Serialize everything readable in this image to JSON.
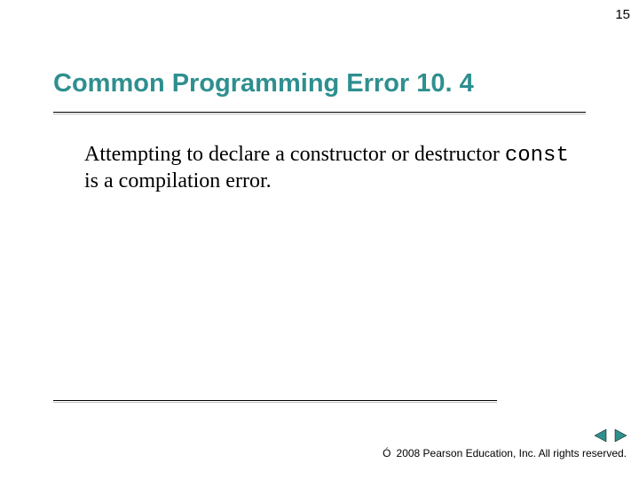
{
  "page_number": "15",
  "title": "Common Programming Error 10. 4",
  "body": {
    "part1": "Attempting to declare a constructor or destructor ",
    "code": "const",
    "part2": " is a compilation error."
  },
  "footer": {
    "copyright_symbol": "Ó",
    "text": " 2008 Pearson Education, Inc.  All rights reserved."
  },
  "nav": {
    "prev_icon": "triangle-left",
    "next_icon": "triangle-right",
    "accent": "#2f8f8f"
  }
}
